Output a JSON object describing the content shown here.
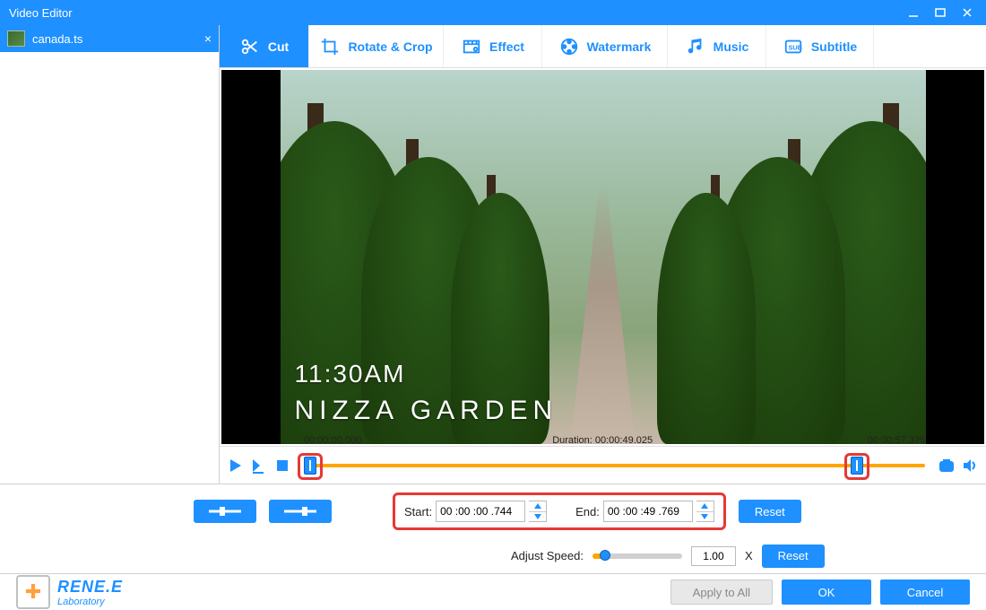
{
  "colors": {
    "accent": "#1e90ff",
    "highlight": "#ffa500",
    "callout": "#e53935"
  },
  "titlebar": {
    "title": "Video Editor"
  },
  "sidebar": {
    "file": {
      "name": "canada.ts"
    }
  },
  "tooltabs": [
    {
      "id": "cut",
      "label": "Cut",
      "active": true
    },
    {
      "id": "rotate",
      "label": "Rotate & Crop"
    },
    {
      "id": "effect",
      "label": "Effect"
    },
    {
      "id": "watermark",
      "label": "Watermark"
    },
    {
      "id": "music",
      "label": "Music"
    },
    {
      "id": "subtitle",
      "label": "Subtitle"
    }
  ],
  "preview": {
    "overlay_time": "11:30AM",
    "overlay_location": "NIZZA GARDEN"
  },
  "timeline": {
    "current_label": "00:00:00.000",
    "duration_label": "Duration: 00:00:49.025",
    "total_label": "00:00:57.375",
    "start_pct": 0,
    "end_pct": 88
  },
  "cut": {
    "start_label": "Start:",
    "start_value": "00 :00 :00 .744",
    "end_label": "End:",
    "end_value": "00 :00 :49 .769",
    "reset_label": "Reset"
  },
  "speed": {
    "label": "Adjust Speed:",
    "value": "1.00",
    "suffix": "X",
    "reset_label": "Reset"
  },
  "logo": {
    "name": "RENE.E",
    "sub": "Laboratory"
  },
  "footer": {
    "apply_all": "Apply to All",
    "ok": "OK",
    "cancel": "Cancel"
  }
}
